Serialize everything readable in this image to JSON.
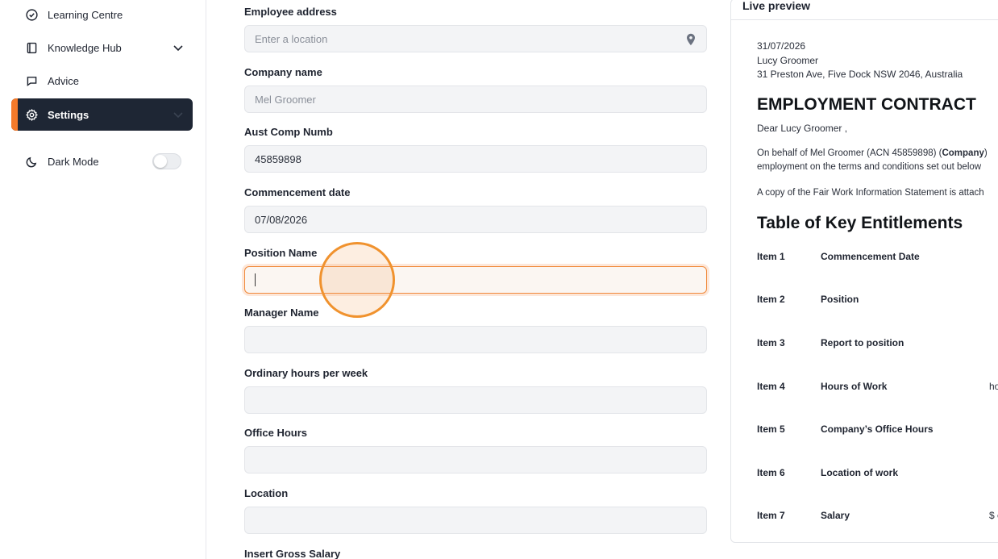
{
  "sidebar": {
    "items": [
      {
        "label": "Learning Centre",
        "icon": "check-circle-icon"
      },
      {
        "label": "Knowledge Hub",
        "icon": "book-icon"
      },
      {
        "label": "Advice",
        "icon": "chat-bubble-icon"
      },
      {
        "label": "Settings",
        "icon": "gear-icon"
      }
    ],
    "dark_mode_label": "Dark Mode",
    "dark_mode_on": false,
    "accent_color": "#f47a2a",
    "active_bg": "#1e2634"
  },
  "form": {
    "fields": [
      {
        "label": "Employee address",
        "value": "",
        "placeholder": "Enter a location"
      },
      {
        "label": "Company name",
        "value": "",
        "placeholder": "Mel Groomer"
      },
      {
        "label": "Aust Comp Numb",
        "value": "45859898",
        "placeholder": ""
      },
      {
        "label": "Commencement date",
        "value": "07/08/2026",
        "placeholder": ""
      },
      {
        "label": "Position Name",
        "value": "",
        "placeholder": ""
      },
      {
        "label": "Manager Name",
        "value": "",
        "placeholder": ""
      },
      {
        "label": "Ordinary hours per week",
        "value": "",
        "placeholder": ""
      },
      {
        "label": "Office Hours",
        "value": "",
        "placeholder": ""
      },
      {
        "label": "Location",
        "value": "",
        "placeholder": ""
      },
      {
        "label": "Insert Gross Salary",
        "value": "",
        "placeholder": ""
      }
    ]
  },
  "preview": {
    "header": "Live preview",
    "date": "31/07/2026",
    "recipient_name": "Lucy Groomer",
    "recipient_address": "31 Preston Ave, Five Dock NSW 2046, Australia",
    "title": "EMPLOYMENT CONTRACT",
    "salutation": "Dear Lucy Groomer ,",
    "para1_start": "On behalf of Mel Groomer (ACN 45859898) (",
    "para1_bold": "Company",
    "para1_end": ")",
    "para1_line2": "employment on the terms and conditions set out below",
    "para2": "A copy of the Fair Work Information Statement is attach",
    "table_title": "Table of Key Entitlements",
    "items": [
      {
        "num": "Item 1",
        "name": "Commencement Date",
        "extra": ""
      },
      {
        "num": "Item 2",
        "name": "Position",
        "extra": ""
      },
      {
        "num": "Item 3",
        "name": "Report to position",
        "extra": ""
      },
      {
        "num": "Item 4",
        "name": "Hours of Work",
        "extra": "ho"
      },
      {
        "num": "Item 5",
        "name": "Company’s Office Hours",
        "extra": ""
      },
      {
        "num": "Item 6",
        "name": "Location of work",
        "extra": ""
      },
      {
        "num": "Item 7",
        "name": "Salary",
        "extra": "$ c"
      }
    ]
  }
}
